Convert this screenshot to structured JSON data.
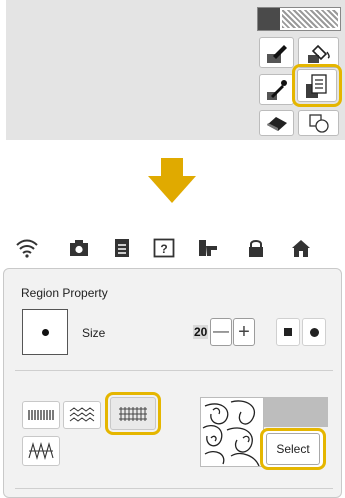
{
  "top_panel": {
    "tools": [
      "line-color-swatch",
      "brush",
      "fill-bucket",
      "eyedropper",
      "region-property",
      "eraser",
      "stamp"
    ]
  },
  "status_bar": {
    "icons": [
      "wifi-icon",
      "camera-icon",
      "document-icon",
      "help-icon",
      "machine-icon",
      "lock-icon",
      "home-icon"
    ]
  },
  "dialog": {
    "title": "Region Property",
    "size_label": "Size",
    "size_value": "20",
    "minus_label": "—",
    "plus_label": "+",
    "select_label": "Select"
  },
  "colors": {
    "highlight": "#e5b600",
    "arrow": "#e0aa00",
    "panel_bg": "#e4e4e4"
  }
}
